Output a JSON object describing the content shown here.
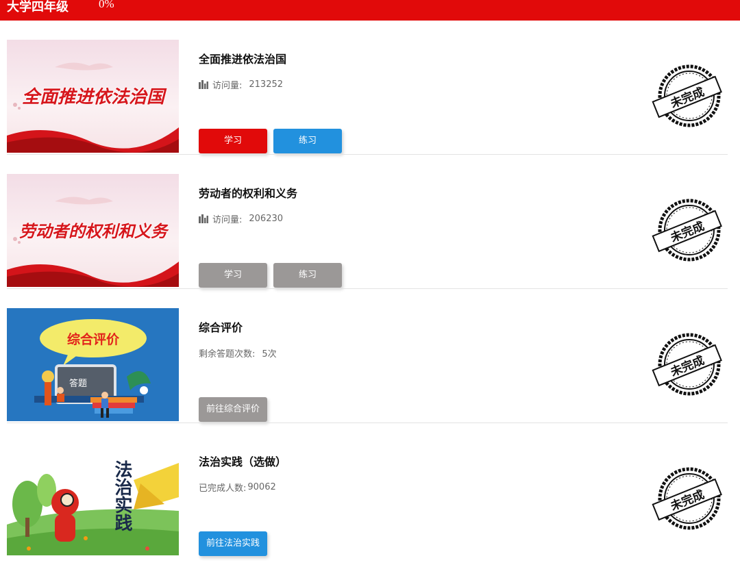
{
  "header": {
    "grade": "大学四年级",
    "progress": "0%"
  },
  "colors": {
    "red": "#e10a0a",
    "blue": "#2291de",
    "grey": "#9b9897"
  },
  "items": [
    {
      "title": "全面推进依法治国",
      "banner_text": "全面推进依法治国",
      "meta_label": "访问量:",
      "meta_value": "213252",
      "meta_icon": "bar-chart-icon",
      "buttons": [
        "学习",
        "练习"
      ],
      "status": "未完成"
    },
    {
      "title": "劳动者的权利和义务",
      "banner_text": "劳动者的权利和义务",
      "meta_label": "访问量:",
      "meta_value": "206230",
      "meta_icon": "bar-chart-icon",
      "buttons": [
        "学习",
        "练习"
      ],
      "status": "未完成"
    },
    {
      "title": "综合评价",
      "banner_text": "综合评价",
      "board_text": "答题",
      "meta_label": "剩余答题次数:",
      "meta_value": "5次",
      "buttons": [
        "前往综合评价"
      ],
      "status": "未完成"
    },
    {
      "title": "法治实践（选做）",
      "banner_text": "法治实践",
      "meta_label": "已完成人数:",
      "meta_value": "90062",
      "buttons": [
        "前往法治实践"
      ],
      "status": "未完成"
    }
  ]
}
